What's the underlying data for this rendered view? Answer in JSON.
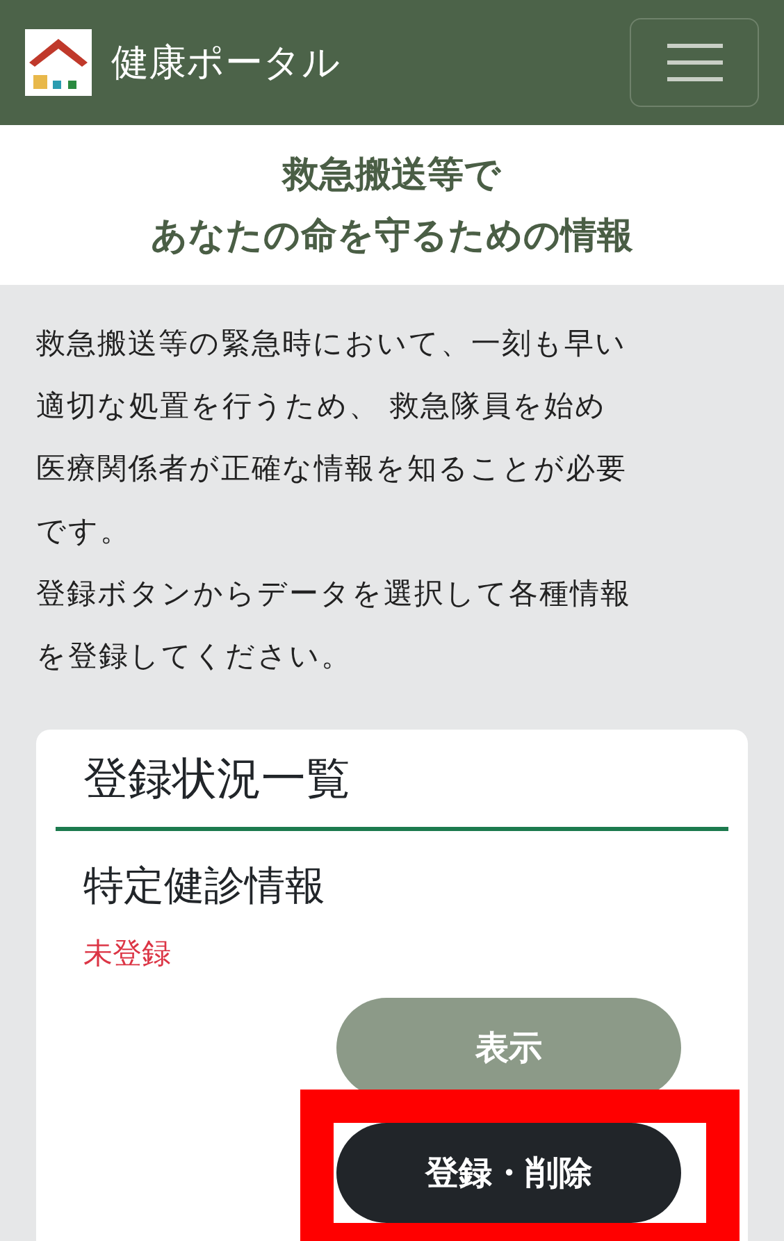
{
  "header": {
    "title": "健康ポータル"
  },
  "page_title": {
    "lines": [
      "救急搬送等で",
      "あなたの命を守るための情報"
    ]
  },
  "intro": [
    {
      "lines": [
        "救急搬送等の緊急時において、一刻も早い",
        "適切な処置を行うため、 救急隊員を始め",
        "医療関係者が正確な情報を知ることが必要",
        "です。"
      ]
    },
    {
      "lines": [
        "登録ボタンからデータを選択して各種情報",
        "を登録してください。"
      ]
    }
  ],
  "card": {
    "title": "登録状況一覧",
    "items": [
      {
        "name": "特定健診情報",
        "status": "未登録",
        "registered": false,
        "buttons": [
          {
            "label": "表示",
            "disabled": true,
            "highlighted": false
          },
          {
            "label": "登録・削除",
            "disabled": false,
            "highlighted": true
          }
        ]
      }
    ]
  }
}
